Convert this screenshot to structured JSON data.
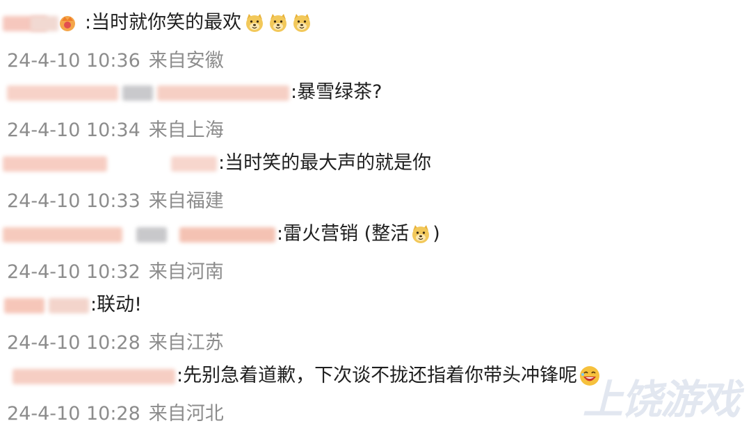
{
  "comments": [
    {
      "text": ":当时就你笑的最欢",
      "emoji_after": [
        "doge",
        "doge",
        "doge"
      ],
      "time": "24-4-10 10:36",
      "location": "来自安徽"
    },
    {
      "text": ":暴雪绿茶?",
      "time": "24-4-10 10:34",
      "location": "来自上海"
    },
    {
      "text": ":当时笑的最大声的就是你",
      "time": "24-4-10 10:33",
      "location": "来自福建"
    },
    {
      "text": ":雷火营销 (整活",
      "text_after_emoji": ")",
      "emoji_after": [
        "doge"
      ],
      "time": "24-4-10 10:32",
      "location": "来自河南"
    },
    {
      "text": ":联动!",
      "time": "24-4-10 10:28",
      "location": "来自江苏"
    },
    {
      "text": ":先别急着道歉，下次谈不拢还指着你带头冲锋呢",
      "emoji_after": [
        "laugh"
      ],
      "time": "24-4-10 10:28",
      "location": "来自河北"
    }
  ],
  "watermark": "上饶游戏"
}
